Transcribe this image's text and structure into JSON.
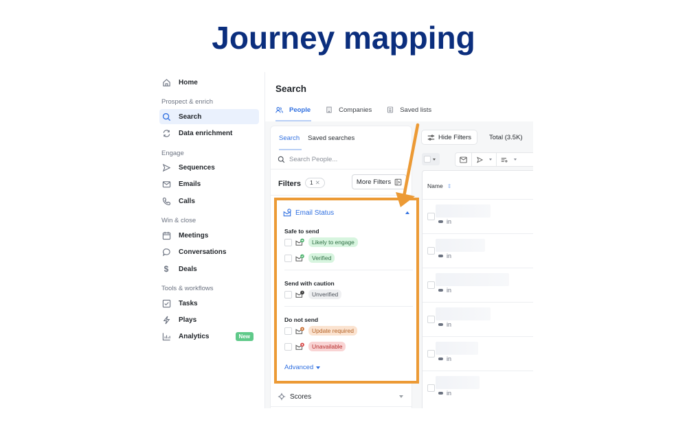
{
  "slide": {
    "title": "Journey mapping"
  },
  "sidebar": {
    "home": "Home",
    "sections": [
      {
        "label": "Prospect & enrich",
        "items": [
          {
            "label": "Search",
            "icon": "search-icon",
            "active": true
          },
          {
            "label": "Data enrichment",
            "icon": "refresh-icon"
          }
        ]
      },
      {
        "label": "Engage",
        "items": [
          {
            "label": "Sequences",
            "icon": "send-icon"
          },
          {
            "label": "Emails",
            "icon": "mail-icon"
          },
          {
            "label": "Calls",
            "icon": "phone-icon"
          }
        ]
      },
      {
        "label": "Win & close",
        "items": [
          {
            "label": "Meetings",
            "icon": "calendar-icon"
          },
          {
            "label": "Conversations",
            "icon": "chat-icon"
          },
          {
            "label": "Deals",
            "icon": "dollar-icon"
          }
        ]
      },
      {
        "label": "Tools & workflows",
        "items": [
          {
            "label": "Tasks",
            "icon": "checkbox-icon"
          },
          {
            "label": "Plays",
            "icon": "bolt-icon"
          },
          {
            "label": "Analytics",
            "icon": "bar-chart-icon",
            "badge": "New"
          }
        ]
      }
    ]
  },
  "main": {
    "title": "Search",
    "tabs": [
      {
        "label": "People",
        "active": true
      },
      {
        "label": "Companies"
      },
      {
        "label": "Saved lists"
      }
    ]
  },
  "filters": {
    "sub_tabs": [
      "Search",
      "Saved searches"
    ],
    "search_placeholder": "Search People...",
    "label": "Filters",
    "count": "1",
    "more_filters": "More Filters",
    "email_status": {
      "title": "Email Status",
      "groups": [
        {
          "label": "Safe to send",
          "options": [
            {
              "label": "Likely to engage",
              "style": "green"
            },
            {
              "label": "Verified",
              "style": "green"
            }
          ]
        },
        {
          "label": "Send with caution",
          "options": [
            {
              "label": "Unverified",
              "style": "gray"
            }
          ]
        },
        {
          "label": "Do not send",
          "options": [
            {
              "label": "Update required",
              "style": "orange"
            },
            {
              "label": "Unavailable",
              "style": "red"
            }
          ]
        }
      ],
      "advanced": "Advanced"
    },
    "scores": "Scores"
  },
  "results": {
    "hide_filters": "Hide Filters",
    "total": "Total (3.5K)",
    "column_name": "Name",
    "rows": [
      {
        "social": "in"
      },
      {
        "social": "in"
      },
      {
        "social": "in"
      },
      {
        "social": "in"
      },
      {
        "social": "in"
      },
      {
        "social": "in"
      }
    ]
  },
  "colors": {
    "highlight": "#ec9a35",
    "accent": "#2f6fe0",
    "title": "#0b2e7d"
  }
}
